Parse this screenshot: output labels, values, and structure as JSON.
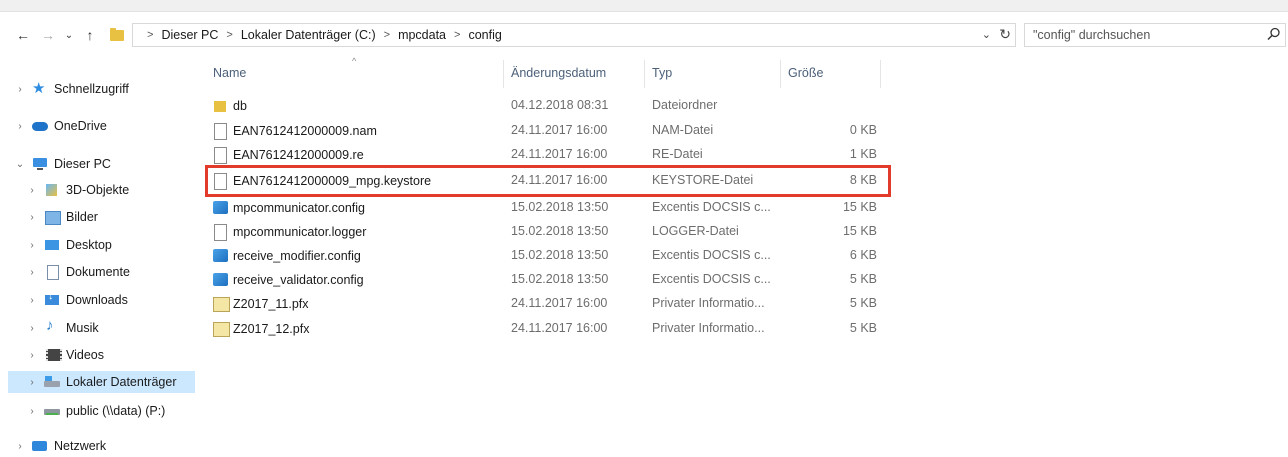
{
  "breadcrumb": [
    "Dieser PC",
    "Lokaler Datenträger (C:)",
    "mpcdata",
    "config"
  ],
  "search": {
    "placeholder": "\"config\" durchsuchen"
  },
  "columns": {
    "name": "Name",
    "date": "Änderungsdatum",
    "type": "Typ",
    "size": "Größe"
  },
  "sidebar": {
    "items": [
      {
        "label": "Schnellzugriff",
        "icon": "star-icon",
        "chevron": "›"
      },
      {
        "label": "OneDrive",
        "icon": "cloud-icon",
        "chevron": "›"
      },
      {
        "label": "Dieser PC",
        "icon": "computer-icon",
        "chevron": "⌄"
      },
      {
        "label": "3D-Objekte",
        "icon": "3d-objects-icon",
        "chevron": "›"
      },
      {
        "label": "Bilder",
        "icon": "pictures-icon",
        "chevron": "›"
      },
      {
        "label": "Desktop",
        "icon": "desktop-icon",
        "chevron": "›"
      },
      {
        "label": "Dokumente",
        "icon": "documents-icon",
        "chevron": "›"
      },
      {
        "label": "Downloads",
        "icon": "downloads-icon",
        "chevron": "›"
      },
      {
        "label": "Musik",
        "icon": "music-icon",
        "chevron": "›"
      },
      {
        "label": "Videos",
        "icon": "videos-icon",
        "chevron": "›"
      },
      {
        "label": "Lokaler Datenträger",
        "icon": "drive-icon",
        "chevron": "›"
      },
      {
        "label": "public (\\\\data) (P:)",
        "icon": "network-drive-icon",
        "chevron": "›"
      },
      {
        "label": "Netzwerk",
        "icon": "network-icon",
        "chevron": "›"
      }
    ]
  },
  "files": [
    {
      "name": "db",
      "date": "04.12.2018 08:31",
      "type": "Dateiordner",
      "size": "",
      "icon": "folder-icon"
    },
    {
      "name": "EAN7612412000009.nam",
      "date": "24.11.2017 16:00",
      "type": "NAM-Datei",
      "size": "0 KB",
      "icon": "file-icon"
    },
    {
      "name": "EAN7612412000009.re",
      "date": "24.11.2017 16:00",
      "type": "RE-Datei",
      "size": "1 KB",
      "icon": "file-icon"
    },
    {
      "name": "EAN7612412000009_mpg.keystore",
      "date": "24.11.2017 16:00",
      "type": "KEYSTORE-Datei",
      "size": "8 KB",
      "icon": "file-icon"
    },
    {
      "name": "mpcommunicator.config",
      "date": "15.02.2018 13:50",
      "type": "Excentis DOCSIS c...",
      "size": "15 KB",
      "icon": "config-icon"
    },
    {
      "name": "mpcommunicator.logger",
      "date": "15.02.2018 13:50",
      "type": "LOGGER-Datei",
      "size": "15 KB",
      "icon": "file-icon"
    },
    {
      "name": "receive_modifier.config",
      "date": "15.02.2018 13:50",
      "type": "Excentis DOCSIS c...",
      "size": "6 KB",
      "icon": "config-icon"
    },
    {
      "name": "receive_validator.config",
      "date": "15.02.2018 13:50",
      "type": "Excentis DOCSIS c...",
      "size": "5 KB",
      "icon": "config-icon"
    },
    {
      "name": "Z2017_11.pfx",
      "date": "24.11.2017 16:00",
      "type": "Privater Informatio...",
      "size": "5 KB",
      "icon": "certificate-icon"
    },
    {
      "name": "Z2017_12.pfx",
      "date": "24.11.2017 16:00",
      "type": "Privater Informatio...",
      "size": "5 KB",
      "icon": "certificate-icon"
    }
  ],
  "colors": {
    "highlight": "#e23a2b",
    "selected": "#cce8ff",
    "header_text": "#4c607a"
  }
}
